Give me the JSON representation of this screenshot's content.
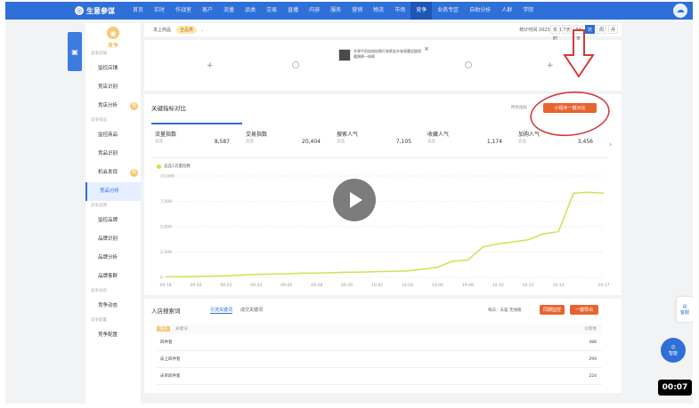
{
  "app": {
    "name": "生意参谋",
    "nav": [
      "首页",
      "实时",
      "作战室",
      "客户",
      "流量",
      "品类",
      "交易",
      "直播",
      "内容",
      "服务",
      "营销",
      "物流",
      "市场",
      "竞争",
      "业务专区",
      "自助分析",
      "人群",
      "学院"
    ],
    "nav_active_index": 13,
    "accent_color": "#2f6fd8"
  },
  "left_float": {
    "icon": "monitor-icon"
  },
  "sidebar": {
    "title": "竞争",
    "sections": [
      {
        "label": "竞争店铺",
        "items": [
          {
            "label": "监控店铺"
          },
          {
            "label": "竞店识别"
          },
          {
            "label": "竞店分析",
            "hot": "热"
          }
        ]
      },
      {
        "label": "竞争商品",
        "items": [
          {
            "label": "监控商品"
          },
          {
            "label": "竞品识别"
          },
          {
            "label": "机会发现",
            "hot": "热"
          },
          {
            "label": "竞品分析",
            "active": true
          }
        ]
      },
      {
        "label": "竞争品牌",
        "items": [
          {
            "label": "监控品牌"
          },
          {
            "label": "品牌识别"
          },
          {
            "label": "品牌分析"
          },
          {
            "label": "品牌客群"
          }
        ]
      },
      {
        "label": "竞争动态",
        "items": [
          {
            "label": "竞争动态"
          }
        ]
      },
      {
        "label": "竞争配置",
        "items": [
          {
            "label": "竞争配置"
          }
        ]
      }
    ]
  },
  "filterbar": {
    "category_label": "本上商品",
    "category_value": "全品类",
    "stat_time": "统计时间 2023-10-17",
    "time_buttons": [
      "实时",
      "7天",
      "30天",
      "日",
      "周",
      "月"
    ],
    "active_time_index": 3
  },
  "compare": {
    "add_symbol": "+",
    "product_text": "冬季牛奶加绒加厚打底裤女外穿高腰显瘦保暖棉裤一体裤",
    "close_symbol": "×"
  },
  "metrics": {
    "title": "关键指标对比",
    "links": "所有指标",
    "compare_button": "小程序一键对比",
    "next_symbol": "›",
    "tabs": [
      {
        "label": "流量指数",
        "sub": "竞品",
        "value": "8,587"
      },
      {
        "label": "交易指数",
        "sub": "竞品",
        "value": "20,404"
      },
      {
        "label": "搜索人气",
        "sub": "竞品",
        "value": "7,105"
      },
      {
        "label": "收藏人气",
        "sub": "竞品",
        "value": "1,174"
      },
      {
        "label": "加购人气",
        "sub": "竞品",
        "value": "3,456"
      }
    ],
    "active_tab_index": 0
  },
  "chart_data": {
    "type": "line",
    "legend": [
      "竞品1流量指数"
    ],
    "y_ticks": [
      "10,000",
      "7,500",
      "5,000",
      "2,500",
      "0"
    ],
    "ylim": [
      0,
      10000
    ],
    "x": [
      "09-18",
      "09-19",
      "09-20",
      "09-21",
      "09-22",
      "09-23",
      "09-24",
      "09-25",
      "09-26",
      "09-27",
      "09-28",
      "09-29",
      "09-30",
      "10-01",
      "10-02",
      "10-03",
      "10-04",
      "10-05",
      "10-06",
      "10-07",
      "10-08",
      "10-09",
      "10-10",
      "10-11",
      "10-12",
      "10-13",
      "10-14",
      "10-15",
      "10-16",
      "10-17"
    ],
    "x_tick_labels": [
      "09-18",
      "09-20",
      "09-22",
      "09-24",
      "09-26",
      "09-28",
      "09-30",
      "10-02",
      "10-04",
      "10-06",
      "10-08",
      "10-10",
      "10-12",
      "10-14",
      "10-17"
    ],
    "series": [
      {
        "color": "#d6df52",
        "values": [
          50,
          60,
          80,
          120,
          160,
          220,
          280,
          320,
          350,
          400,
          420,
          460,
          500,
          520,
          560,
          600,
          640,
          800,
          1000,
          1600,
          1700,
          3000,
          3300,
          3500,
          3700,
          4300,
          4500,
          8300,
          8400,
          8300
        ]
      }
    ]
  },
  "keywords": {
    "title": "入店搜索词",
    "tabs": [
      "引流关键词",
      "成交关键词"
    ],
    "active_tab_index": 0,
    "filter": "每日：天猫 无线端",
    "btn_monitor": "同期监控",
    "btn_export": "一键导出",
    "header": {
      "rank": "排名",
      "name": "关键词",
      "value": "访客数"
    },
    "rows": [
      {
        "name": "四件套",
        "value": "488"
      },
      {
        "name": "床上四件套",
        "value": "299"
      },
      {
        "name": "床单四件套",
        "value": "224"
      }
    ]
  },
  "side_help": {
    "label": "客服"
  },
  "chat": {
    "label": "智能"
  },
  "video": {
    "timer": "00:07"
  }
}
